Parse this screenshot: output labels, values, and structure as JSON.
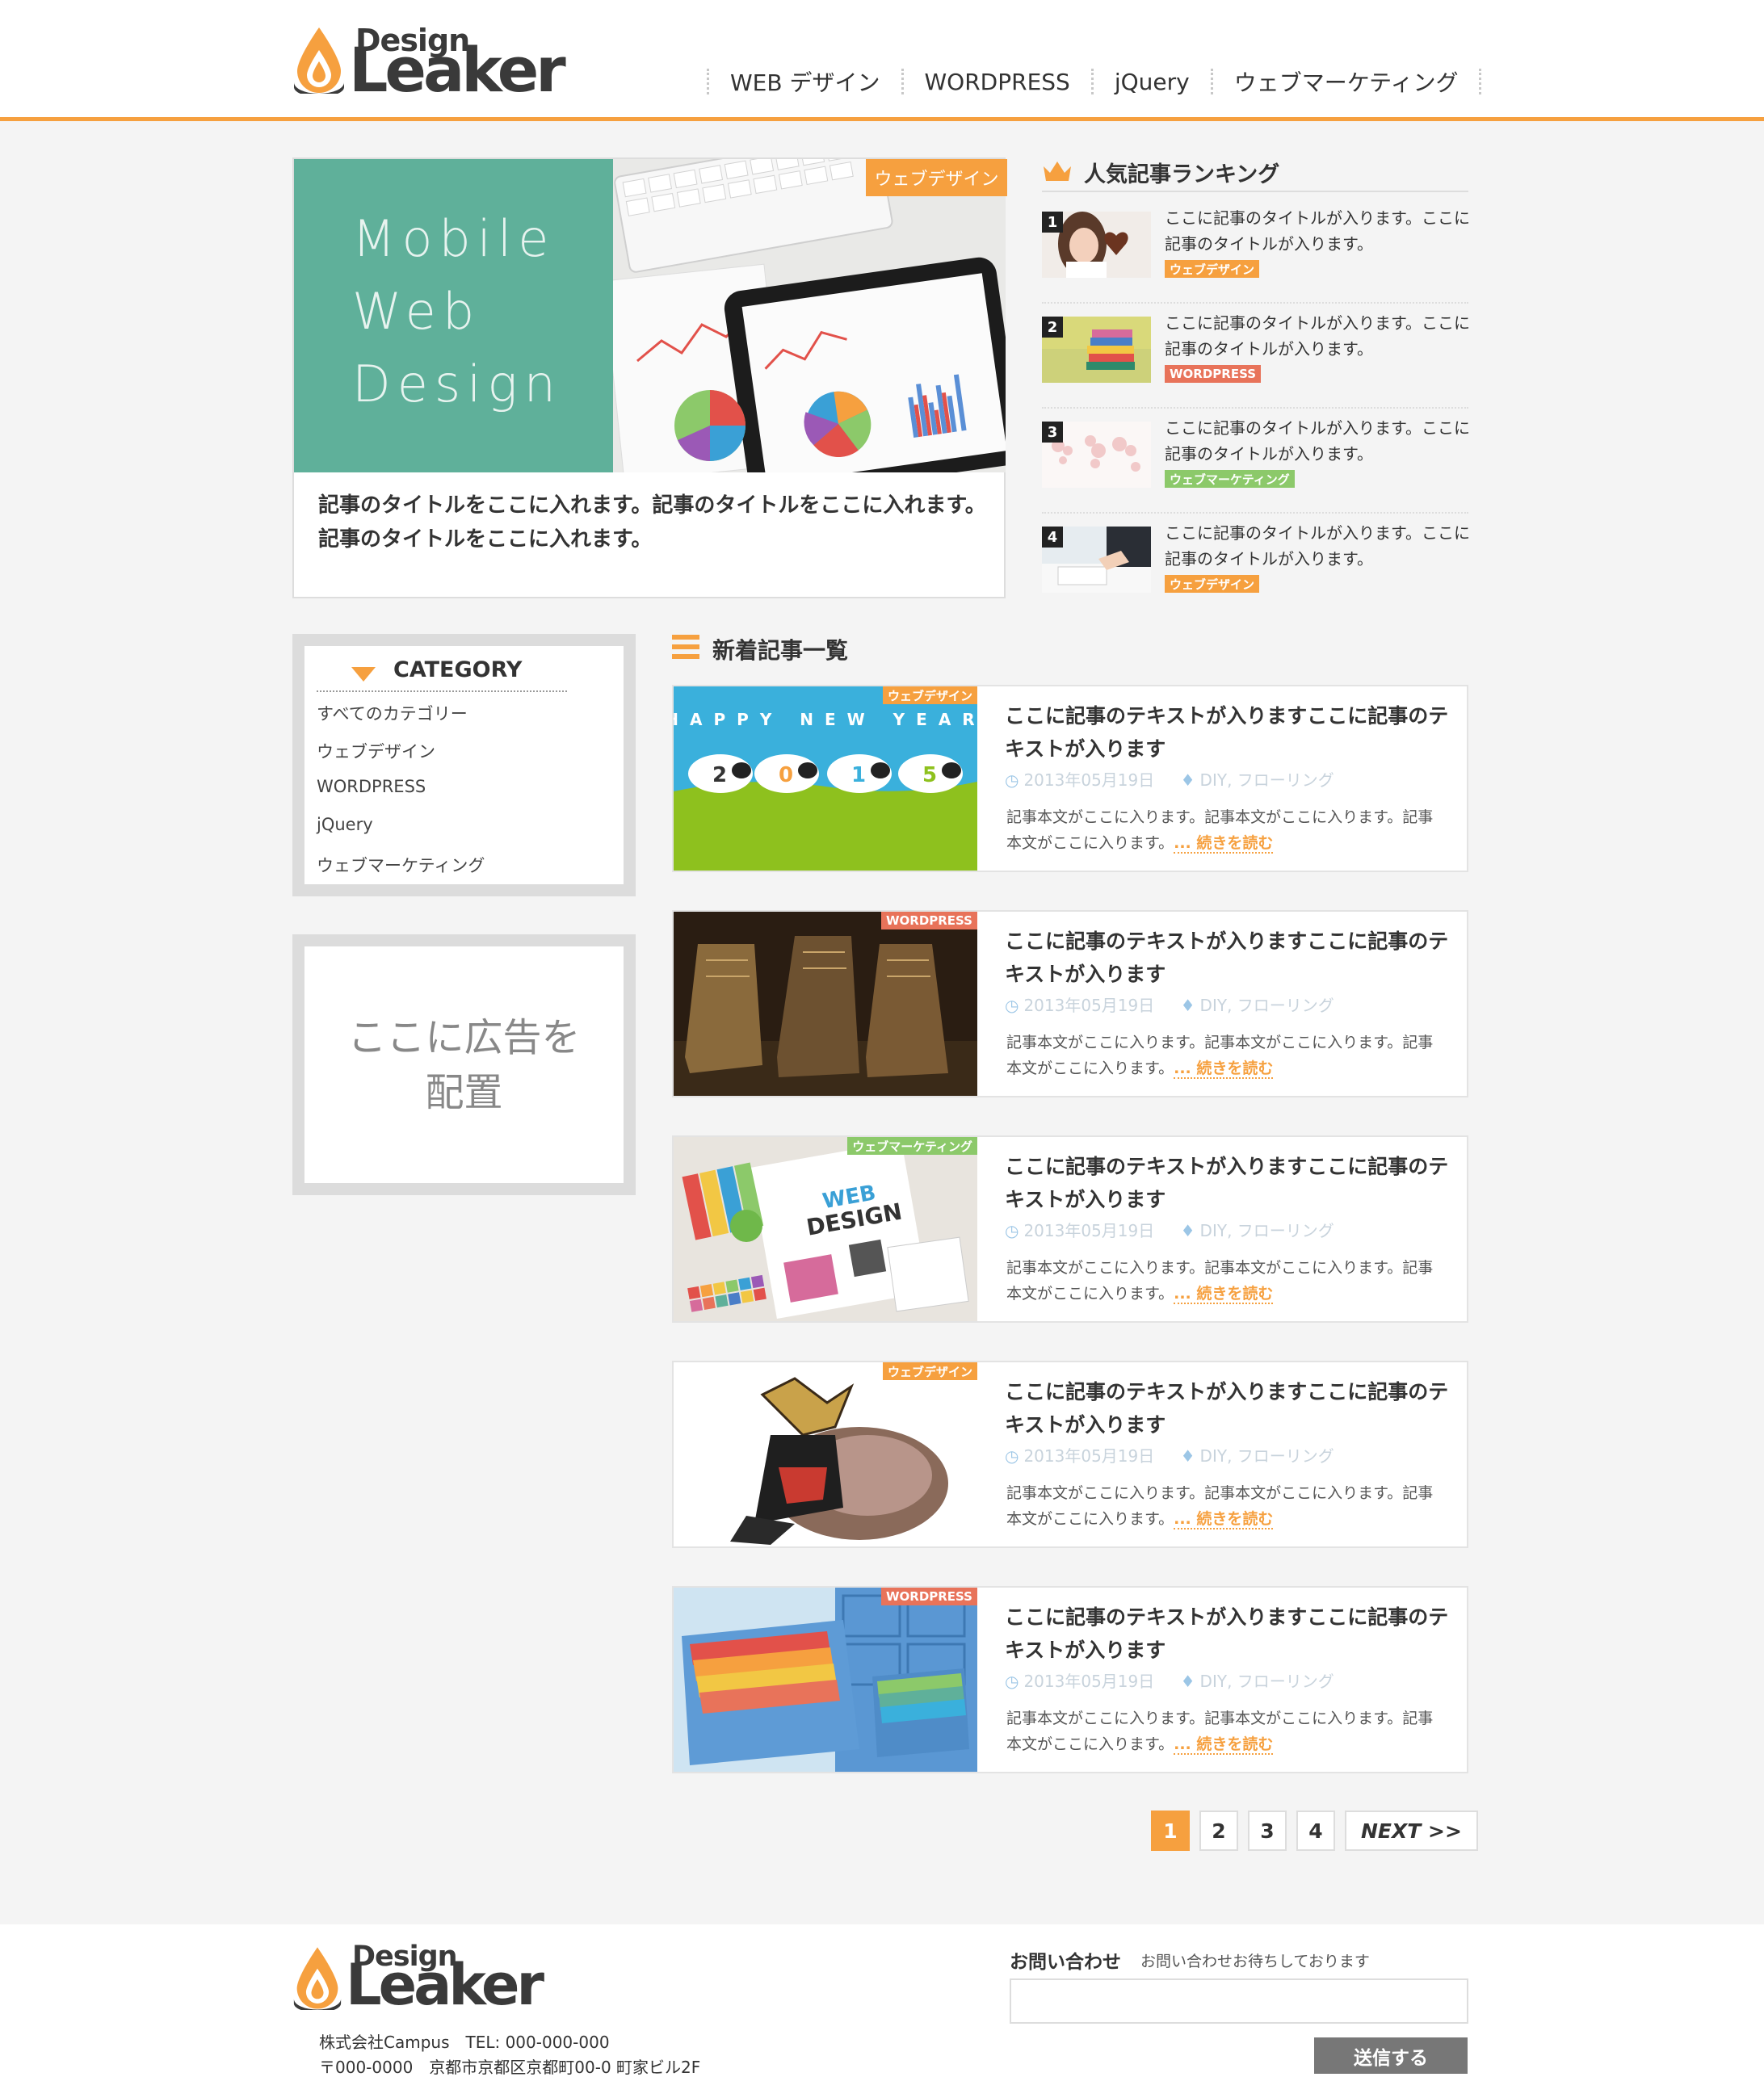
{
  "brand": {
    "logo_top": "Design",
    "logo_main": "Leaker",
    "accent": "#f6a03f"
  },
  "nav": [
    {
      "label": "WEB デザイン"
    },
    {
      "label": "WORDPRESS"
    },
    {
      "label": "jQuery"
    },
    {
      "label": "ウェブマーケティング"
    }
  ],
  "featured": {
    "lines": [
      "Mobile",
      "Web",
      "Design"
    ],
    "badge": "ウェブデザイン",
    "title": "記事のタイトルをここに入れます。記事のタイトルをここに入れます。記事のタイトルをここに入れます。"
  },
  "ranking": {
    "title": "人気記事ランキング",
    "items": [
      {
        "num": "1",
        "text": "ここに記事のタイトルが入ります。ここに記事のタイトルが入ります。",
        "tag": "ウェブデザイン",
        "tag_color": "#f6a03f"
      },
      {
        "num": "2",
        "text": "ここに記事のタイトルが入ります。ここに記事のタイトルが入ります。",
        "tag": "WORDPRESS",
        "tag_color": "#e8735a"
      },
      {
        "num": "3",
        "text": "ここに記事のタイトルが入ります。ここに記事のタイトルが入ります。",
        "tag": "ウェブマーケティング",
        "tag_color": "#8cc96a"
      },
      {
        "num": "4",
        "text": "ここに記事のタイトルが入ります。ここに記事のタイトルが入ります。",
        "tag": "ウェブデザイン",
        "tag_color": "#f6a03f"
      }
    ]
  },
  "category": {
    "title": "CATEGORY",
    "items": [
      "すべてのカテゴリー",
      "ウェブデザイン",
      "WORDPRESS",
      "jQuery",
      "ウェブマーケティング"
    ]
  },
  "ad": {
    "line1": "ここに広告を",
    "line2": "配置"
  },
  "new_articles": {
    "title": "新着記事一覧",
    "posts": [
      {
        "tag": "ウェブデザイン",
        "tag_color": "#f6a03f",
        "title": "ここに記事のテキストが入りますここに記事のテキストが入ります",
        "date": "2013年05月19日",
        "tags": "DIY, フローリング",
        "body": "記事本文がここに入ります。記事本文がここに入ります。記事本文がここに入ります。",
        "more": "... 続きを読む",
        "img_text": "HAPPY NEW YEAR",
        "img_digits": [
          "2",
          "0",
          "1",
          "5"
        ]
      },
      {
        "tag": "WORDPRESS",
        "tag_color": "#e8735a",
        "title": "ここに記事のテキストが入りますここに記事のテキストが入ります",
        "date": "2013年05月19日",
        "tags": "DIY, フローリング",
        "body": "記事本文がここに入ります。記事本文がここに入ります。記事本文がここに入ります。",
        "more": "... 続きを読む"
      },
      {
        "tag": "ウェブマーケティング",
        "tag_color": "#8cc96a",
        "title": "ここに記事のテキストが入りますここに記事のテキストが入ります",
        "date": "2013年05月19日",
        "tags": "DIY, フローリング",
        "body": "記事本文がここに入ります。記事本文がここに入ります。記事本文がここに入ります。",
        "more": "... 続きを読む",
        "img_text1": "WEB",
        "img_text2": "DESIGN"
      },
      {
        "tag": "ウェブデザイン",
        "tag_color": "#f6a03f",
        "title": "ここに記事のテキストが入りますここに記事のテキストが入ります",
        "date": "2013年05月19日",
        "tags": "DIY, フローリング",
        "body": "記事本文がここに入ります。記事本文がここに入ります。記事本文がここに入ります。",
        "more": "... 続きを読む"
      },
      {
        "tag": "WORDPRESS",
        "tag_color": "#e8735a",
        "title": "ここに記事のテキストが入りますここに記事のテキストが入ります",
        "date": "2013年05月19日",
        "tags": "DIY, フローリング",
        "body": "記事本文がここに入ります。記事本文がここに入ります。記事本文がここに入ります。",
        "more": "... 続きを読む"
      }
    ]
  },
  "pagination": {
    "pages": [
      "1",
      "2",
      "3",
      "4"
    ],
    "next": "NEXT >>",
    "current": "1"
  },
  "footer": {
    "company_line1": "株式会社Campus　TEL: 000-000-000",
    "company_line2": "〒000-0000　京都市京都区京都町00-0 町家ビル2F",
    "contact_label": "お問い合わせ",
    "contact_sub": "お問い合わせお待ちしております",
    "submit": "送信する"
  }
}
